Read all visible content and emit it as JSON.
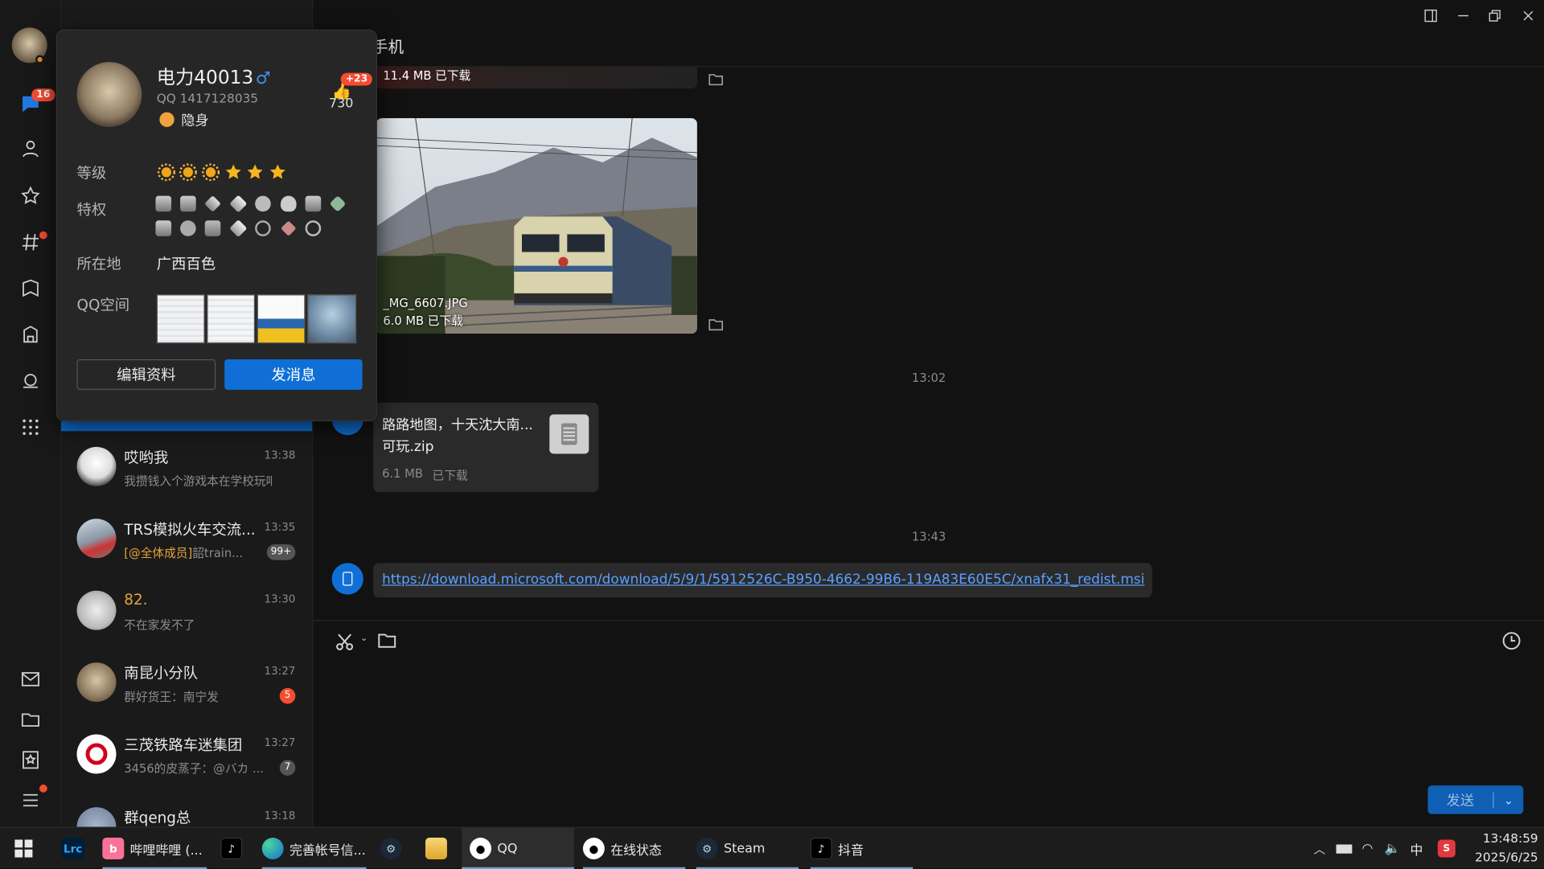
{
  "rail": {
    "chat_badge": "16"
  },
  "profile": {
    "name": "电力40013",
    "gender_symbol": "♂",
    "qq": "QQ 1417128035",
    "status": "隐身",
    "likes": "730",
    "likes_new": "+23",
    "level_label": "等级",
    "privilege_label": "特权",
    "location_label": "所在地",
    "location": "广西百色",
    "qzone_label": "QQ空间",
    "edit_button": "编辑资料",
    "message_button": "发消息"
  },
  "chats": [
    {
      "name": "哎哟我",
      "time": "13:38",
      "preview": "我攒钱入个游戏本在学校玩吧",
      "count": ""
    },
    {
      "name": "TRS模拟火车交流...",
      "time": "13:35",
      "mention": "[@全体成员]",
      "preview": "韶train...",
      "count": "99+"
    },
    {
      "name": "82.",
      "time": "13:30",
      "preview": "不在家发不了",
      "count": ""
    },
    {
      "name": "南昆小分队",
      "time": "13:27",
      "preview": "群好货王：南宁发",
      "count": "5"
    },
    {
      "name": "三茂铁路车迷集团",
      "time": "13:27",
      "preview": "3456的皮蒸子：@バカ ...",
      "count": "7"
    },
    {
      "name": "群qeng总",
      "time": "13:18",
      "preview": "",
      "count": ""
    }
  ],
  "conversation": {
    "title": "手机",
    "file1_info": "11.4 MB 已下载",
    "photo_name": "_MG_6607.JPG",
    "photo_info": "6.0 MB 已下载",
    "time1": "13:02",
    "zip_name_line1": "路路地图，十天沈大南...",
    "zip_name_line2": "可玩.zip",
    "zip_size": "6.1 MB",
    "zip_status": "已下载",
    "time2": "13:43",
    "link": "https://download.microsoft.com/download/5/9/1/5912526C-B950-4662-99B6-119A83E60E5C/xnafx31_redist.msi",
    "send_button": "发送"
  },
  "taskbar": {
    "items": [
      "哔哩哔哩 (...",
      "完善帐号信...",
      "QQ",
      "在线状态",
      "Steam",
      "抖音"
    ],
    "lrc": "Lrc",
    "ime": "中",
    "time": "13:48:59",
    "date": "2025/6/25"
  },
  "colors": {
    "accent": "#0f6fd6",
    "badge": "#f74c31",
    "link": "#5aa0ff"
  }
}
